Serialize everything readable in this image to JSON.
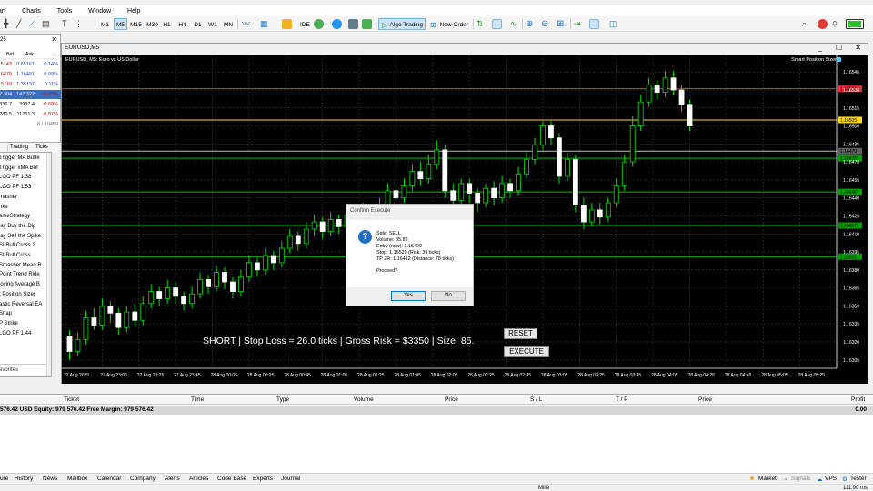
{
  "menu": [
    "art",
    "Charts",
    "Tools",
    "Window",
    "Help"
  ],
  "toolbar": {
    "timeframes": [
      "M1",
      "M5",
      "M15",
      "M30",
      "H1",
      "H4",
      "D1",
      "W1",
      "MN"
    ],
    "active_timeframe": "M5",
    "ide_label": "IDE",
    "algo_trading_label": "Algo Trading",
    "new_order_label": "New Order"
  },
  "market_watch": {
    "title": "25",
    "col_bid": "Bid",
    "col_ask": "Ask",
    "col_more": "...",
    "rows": [
      {
        "bid": "5143",
        "ask": "0.65161",
        "change": "0.14%",
        "bid_color": "#c00000"
      },
      {
        "bid": "6479",
        "ask": "1.16491",
        "change": "0.09%",
        "bid_color": "#c00000"
      },
      {
        "bid": "5119",
        "ask": "1.35137",
        "change": "0.11%",
        "bid_color": "#c00000"
      },
      {
        "bid": "7.304",
        "ask": "147.322",
        "change": "-0.07%",
        "bid_color": "#ffffff",
        "highlight": true
      },
      {
        "bid": "336.7",
        "ask": "3937.4",
        "change": "-0.68%",
        "bid_color": "#000000"
      },
      {
        "bid": "780.5",
        "ask": "11761.3",
        "change": "-0.87%",
        "bid_color": "#000000"
      }
    ],
    "count": "6 / 10459",
    "tabs": [
      "",
      "Trading",
      "Ticks"
    ]
  },
  "navigator": {
    "items": [
      "Trigger MA Buffe",
      "Trigger xMA Buf",
      "LGO PF 1.38",
      "LGO PF 1.53",
      "masher",
      "nke",
      "ameStrategy",
      "lay Buy the Dip",
      "lay Sell the Spike",
      "SI Bull Cross 2",
      "SI Bull Cross",
      "Smasher Mean R",
      "Point Trend Ride",
      "loving Average B",
      "t Position Sizer",
      "astic Reversal EA",
      "Snap",
      "P Strike",
      "LGO PF 1.44"
    ],
    "footer": "avorites"
  },
  "chart_window": {
    "title": "EURUSD,M5",
    "chart_label": "EURUSD, M5:  Euro vs US Dollar",
    "ea_label": "Smart Position Sizer",
    "minimize": "_",
    "maximize": "☐",
    "close": "✕"
  },
  "chart_data": {
    "type": "candlestick",
    "price_axis_labels": [
      "1.16545",
      "1.16530",
      "1.16515",
      "1.16500",
      "1.16485",
      "1.16470",
      "1.16455",
      "1.16440",
      "1.16425",
      "1.16410",
      "1.16395",
      "1.16380",
      "1.16365",
      "1.16350",
      "1.16335",
      "1.16320",
      "1.16305"
    ],
    "ylim": [
      1.16298,
      1.16555
    ],
    "time_axis_labels": [
      "27 Aug 2025",
      "27 Aug 23:05",
      "27 Aug 23:25",
      "27 Aug 23:45",
      "28 Aug 00:05",
      "28 Aug 00:25",
      "28 Aug 00:45",
      "28 Aug 01:05",
      "28 Aug 01:25",
      "28 Aug 01:45",
      "28 Aug 02:05",
      "28 Aug 02:25",
      "28 Aug 02:45",
      "28 Aug 03:05",
      "28 Aug 03:25",
      "28 Aug 03:45",
      "28 Aug 04:05",
      "28 Aug 04:25",
      "28 Aug 04:45",
      "28 Aug 05:05",
      "28 Aug 05:25"
    ],
    "candles": [
      [
        1.16325,
        1.16312,
        1.1633,
        1.16305
      ],
      [
        1.16312,
        1.16322,
        1.16328,
        1.16308
      ],
      [
        1.16322,
        1.1634,
        1.16346,
        1.16318
      ],
      [
        1.1634,
        1.16334,
        1.16348,
        1.1633
      ],
      [
        1.16334,
        1.1635,
        1.16356,
        1.1633
      ],
      [
        1.1635,
        1.16344,
        1.16354,
        1.16336
      ],
      [
        1.16344,
        1.16332,
        1.16348,
        1.16326
      ],
      [
        1.16332,
        1.16345,
        1.1635,
        1.16328
      ],
      [
        1.16345,
        1.16338,
        1.16352,
        1.16332
      ],
      [
        1.16338,
        1.16352,
        1.16358,
        1.16334
      ],
      [
        1.16352,
        1.16362,
        1.16368,
        1.16348
      ],
      [
        1.16362,
        1.16356,
        1.16366,
        1.1635
      ],
      [
        1.16356,
        1.16365,
        1.16372,
        1.16352
      ],
      [
        1.16365,
        1.16358,
        1.1637,
        1.16352
      ],
      [
        1.16358,
        1.16352,
        1.16362,
        1.16346
      ],
      [
        1.16352,
        1.1636,
        1.16366,
        1.16348
      ],
      [
        1.1636,
        1.16372,
        1.16378,
        1.16356
      ],
      [
        1.16372,
        1.16366,
        1.16376,
        1.1636
      ],
      [
        1.16366,
        1.16378,
        1.16384,
        1.16362
      ],
      [
        1.16378,
        1.1637,
        1.16382,
        1.16364
      ],
      [
        1.1637,
        1.16362,
        1.16374,
        1.16356
      ],
      [
        1.16362,
        1.16374,
        1.1638,
        1.16358
      ],
      [
        1.16374,
        1.16386,
        1.16392,
        1.1637
      ],
      [
        1.16386,
        1.1638,
        1.1639,
        1.16374
      ],
      [
        1.1638,
        1.16392,
        1.16398,
        1.16376
      ],
      [
        1.16392,
        1.16386,
        1.16396,
        1.1638
      ],
      [
        1.16386,
        1.16398,
        1.16404,
        1.16382
      ],
      [
        1.16398,
        1.16408,
        1.16414,
        1.16394
      ],
      [
        1.16408,
        1.16402,
        1.16412,
        1.16396
      ],
      [
        1.16402,
        1.16414,
        1.1642,
        1.16398
      ],
      [
        1.16414,
        1.1642,
        1.16426,
        1.16408
      ],
      [
        1.1642,
        1.16412,
        1.16424,
        1.16406
      ],
      [
        1.16412,
        1.16422,
        1.16428,
        1.16408
      ],
      [
        1.16422,
        1.16416,
        1.16426,
        1.1641
      ],
      [
        1.16416,
        1.16426,
        1.16432,
        1.16412
      ],
      [
        1.16426,
        1.1642,
        1.1643,
        1.16414
      ],
      [
        1.1642,
        1.1643,
        1.16436,
        1.16416
      ],
      [
        1.1643,
        1.16424,
        1.16434,
        1.16418
      ],
      [
        1.16424,
        1.16434,
        1.1644,
        1.1642
      ],
      [
        1.16434,
        1.16446,
        1.16452,
        1.1643
      ],
      [
        1.16446,
        1.1644,
        1.16452,
        1.16434
      ],
      [
        1.1644,
        1.1645,
        1.16456,
        1.16436
      ],
      [
        1.1645,
        1.16462,
        1.16468,
        1.16446
      ],
      [
        1.16462,
        1.16456,
        1.1647,
        1.1645
      ],
      [
        1.16456,
        1.16468,
        1.16476,
        1.16452
      ],
      [
        1.16468,
        1.1648,
        1.16488,
        1.16464
      ],
      [
        1.1648,
        1.16446,
        1.16484,
        1.1644
      ],
      [
        1.16446,
        1.16438,
        1.16452,
        1.1643
      ],
      [
        1.16438,
        1.16452,
        1.16456,
        1.16434
      ],
      [
        1.16452,
        1.16444,
        1.16456,
        1.16436
      ],
      [
        1.16444,
        1.16436,
        1.16448,
        1.16428
      ],
      [
        1.16436,
        1.16448,
        1.16452,
        1.16432
      ],
      [
        1.16448,
        1.1644,
        1.16454,
        1.16434
      ],
      [
        1.1644,
        1.16452,
        1.16458,
        1.16436
      ],
      [
        1.16452,
        1.16446,
        1.16456,
        1.1644
      ],
      [
        1.16446,
        1.1646,
        1.16466,
        1.16442
      ],
      [
        1.1646,
        1.16472,
        1.16478,
        1.16456
      ],
      [
        1.16472,
        1.16484,
        1.1649,
        1.16468
      ],
      [
        1.16484,
        1.165,
        1.16504,
        1.1648
      ],
      [
        1.165,
        1.1649,
        1.16504,
        1.16484
      ],
      [
        1.1649,
        1.16458,
        1.16494,
        1.16452
      ],
      [
        1.16458,
        1.16472,
        1.16478,
        1.16454
      ],
      [
        1.16472,
        1.16434,
        1.16476,
        1.16428
      ],
      [
        1.16434,
        1.1642,
        1.1644,
        1.16414
      ],
      [
        1.1642,
        1.1643,
        1.16436,
        1.16416
      ],
      [
        1.1643,
        1.16424,
        1.16436,
        1.16418
      ],
      [
        1.16424,
        1.16436,
        1.1644,
        1.1642
      ],
      [
        1.16436,
        1.1645,
        1.16456,
        1.16432
      ],
      [
        1.1645,
        1.1647,
        1.16476,
        1.16446
      ],
      [
        1.1647,
        1.165,
        1.16508,
        1.16466
      ],
      [
        1.165,
        1.1652,
        1.16526,
        1.16496
      ],
      [
        1.1652,
        1.16534,
        1.1654,
        1.16516
      ],
      [
        1.16534,
        1.16528,
        1.16538,
        1.16522
      ],
      [
        1.16528,
        1.1654,
        1.16546,
        1.16524
      ],
      [
        1.1654,
        1.1653,
        1.16546,
        1.16526
      ],
      [
        1.1653,
        1.16518,
        1.16534,
        1.16512
      ],
      [
        1.16518,
        1.165,
        1.16522,
        1.16496
      ]
    ],
    "horizontal_lines": [
      {
        "label": "1.16531",
        "price": 1.16531,
        "color": "#e03030",
        "tag_color": "#e03030"
      },
      {
        "label": "1.16505",
        "price": 1.16505,
        "color": "#ffd700",
        "tag_color": "#ffd700"
      },
      {
        "label": "1.16479",
        "price": 1.16479,
        "color": "#c0c0c0",
        "tag_color": "#606060"
      },
      {
        "label": "1.16473",
        "price": 1.16473,
        "color": "#00c000",
        "tag_color": "#00a000"
      },
      {
        "label": "1.16445",
        "price": 1.16445,
        "color": "#00c000",
        "tag_color": "#00a000"
      },
      {
        "label": "1.16417",
        "price": 1.16417,
        "color": "#00c000",
        "tag_color": "#00a000"
      },
      {
        "label": "1.16391",
        "price": 1.16391,
        "color": "#00c000",
        "tag_color": "#00a000"
      }
    ],
    "info_text": "SHORT | Stop Loss = 26.0 ticks | Gross Risk = $3350 | Size: 85.",
    "buttons": [
      "RESET",
      "EXECUTE"
    ]
  },
  "dialog": {
    "title": "Confirm Execute",
    "lines": [
      "Side: SELL",
      "Volume: 85.89",
      "Entry (now): 1.16490",
      "Stop: 1.16529  (Risk: 39 ticks)",
      "TP 2R: 1.16412  (Distance: 78 ticks)",
      "",
      "Proceed?"
    ],
    "yes": "Yes",
    "no": "No"
  },
  "terminal": {
    "columns": [
      "Ticket",
      "Time",
      "Type",
      "Volume",
      "Price",
      "S / L",
      "T / P",
      "Price",
      "Profit"
    ],
    "balance_line": "576.42 USD  Equity: 979 576.42  Free Margin: 979 576.42",
    "profit_total": "0.00",
    "tabs": [
      "ure",
      "History",
      "News",
      "Mailbox",
      "Calendar",
      "Company",
      "Alerts",
      "Articles",
      "Code Base",
      "Experts",
      "Journal"
    ],
    "right_items": [
      "Market",
      "Signals",
      "VPS",
      "Tester"
    ]
  },
  "status": {
    "left": "Milie",
    "right": "111.90 ms"
  }
}
